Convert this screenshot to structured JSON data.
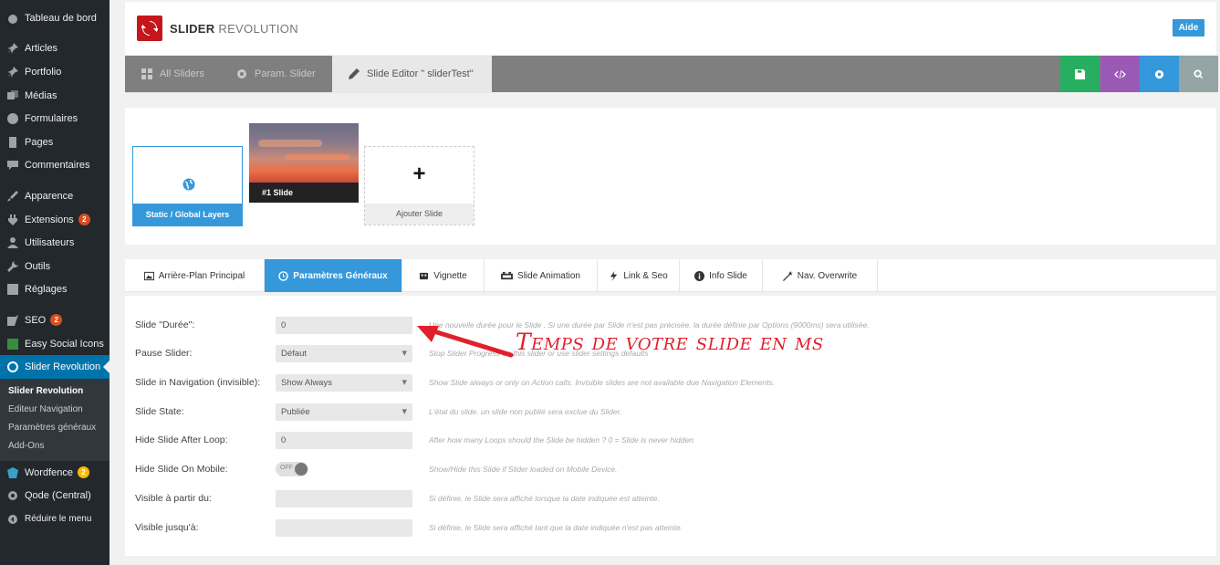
{
  "sidebar": {
    "items": [
      {
        "label": "Tableau de bord",
        "icon": "dashboard-icon"
      },
      {
        "label": "Articles",
        "icon": "pin-icon"
      },
      {
        "label": "Portfolio",
        "icon": "pin-icon"
      },
      {
        "label": "Médias",
        "icon": "media-icon"
      },
      {
        "label": "Formulaires",
        "icon": "forms-icon"
      },
      {
        "label": "Pages",
        "icon": "pages-icon"
      },
      {
        "label": "Commentaires",
        "icon": "comments-icon"
      },
      {
        "label": "Apparence",
        "icon": "appearance-icon"
      },
      {
        "label": "Extensions",
        "icon": "plugins-icon",
        "badge": "2"
      },
      {
        "label": "Utilisateurs",
        "icon": "users-icon"
      },
      {
        "label": "Outils",
        "icon": "tools-icon"
      },
      {
        "label": "Réglages",
        "icon": "settings-icon"
      },
      {
        "label": "SEO",
        "icon": "seo-icon",
        "badge": "2"
      },
      {
        "label": "Easy Social Icons",
        "icon": "share-icon"
      },
      {
        "label": "Slider Revolution",
        "icon": "slider-revolution-icon",
        "active": true
      }
    ],
    "submenu": [
      "Slider Revolution",
      "Editeur Navigation",
      "Paramètres généraux",
      "Add-Ons"
    ],
    "after": [
      {
        "label": "Wordfence",
        "icon": "wordfence-icon",
        "badge": "2"
      },
      {
        "label": "Qode (Central)",
        "icon": "gear-icon"
      },
      {
        "label": "Réduire le menu",
        "icon": "collapse-icon"
      }
    ]
  },
  "header": {
    "logo_bold": "SLIDER",
    "logo_light": " REVOLUTION",
    "help_label": "Aide"
  },
  "tabs": {
    "all_sliders": "All Sliders",
    "slider_params": "Param. Slider",
    "slide_editor": "Slide Editor \" sliderTest\""
  },
  "actions": {
    "save_color": "#27ae60",
    "code_color": "#9b59b6",
    "settings_color": "#3498db",
    "search_color": "#95a5a6"
  },
  "slides": {
    "static_label": "Static / Global Layers",
    "slide1_label": "#1 Slide",
    "add_plus": "+",
    "add_label": "Ajouter Slide"
  },
  "settings_tabs": [
    "Arrière-Plan Principal",
    "Paramètres Généraux",
    "Vignette",
    "Slide Animation",
    "Link & Seo",
    "Info Slide",
    "Nav. Overwrite"
  ],
  "form": {
    "rows": [
      {
        "label": "Slide \"Durée\":",
        "value": "0",
        "desc": "Une nouvelle durée pour le Slide . Si une durée par Slide n'est pas précisée, la durée définie par Options (9000ms) sera utilisée."
      },
      {
        "label": "Pause Slider:",
        "value": "Défaut",
        "desc": "Stop Slider Progress on this slider or use slider settings defaults"
      },
      {
        "label": "Slide in Navigation (invisible):",
        "value": "Show Always",
        "desc": "Show Slide always or only on Action calls. Invisible slides are not available due Navigation Elements."
      },
      {
        "label": "Slide State:",
        "value": "Publiée",
        "desc": "L'état du slide. un slide non publié sera exclue du Slider."
      },
      {
        "label": "Hide Slide After Loop:",
        "value": "0",
        "desc": "After how many Loops should the Slide be hidden ? 0 = Slide is never hidden."
      },
      {
        "label": "Hide Slide On Mobile:",
        "value": "OFF",
        "desc": "Show/Hide this Slide if Slider loaded on Mobile Device."
      },
      {
        "label": "Visible à partir du:",
        "value": "",
        "desc": "Si définie, le Slide sera affiché lorsque la date indiquée est atteinte."
      },
      {
        "label": "Visible jusqu'à:",
        "value": "",
        "desc": "Si définie, le Slide sera affiché tant que la date indiquée n'est pas atteinte."
      }
    ]
  },
  "annotation": {
    "text": "Temps de votre slide en ms",
    "color": "#e0202a"
  }
}
